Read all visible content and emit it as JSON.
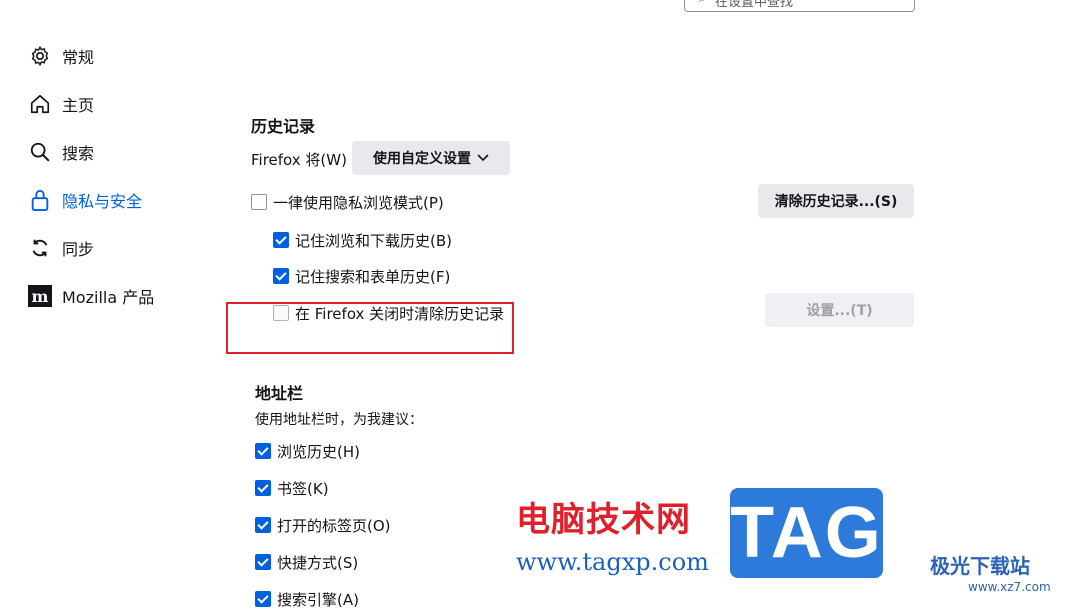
{
  "search": {
    "placeholder_visible": "在设置中查找"
  },
  "sidebar": {
    "items": [
      {
        "label": "常规",
        "icon": "gear-icon"
      },
      {
        "label": "主页",
        "icon": "home-icon"
      },
      {
        "label": "搜索",
        "icon": "search-icon"
      },
      {
        "label": "隐私与安全",
        "icon": "lock-icon",
        "active": true
      },
      {
        "label": "同步",
        "icon": "sync-icon"
      },
      {
        "label": "Mozilla 产品",
        "icon": "mozilla-icon"
      }
    ]
  },
  "history": {
    "title": "历史记录",
    "firefox_will_label": "Firefox 将(W)",
    "mode_select": "使用自定义设置",
    "always_private": {
      "label": "一律使用隐私浏览模式(P)",
      "checked": false
    },
    "clear_button": "清除历史记录...(S)",
    "remember_browsing": {
      "label": "记住浏览和下载历史(B)",
      "checked": true
    },
    "remember_search": {
      "label": "记住搜索和表单历史(F)",
      "checked": true
    },
    "clear_on_close": {
      "label": "在 Firefox 关闭时清除历史记录",
      "checked": false
    },
    "settings_button": "设置...(T)"
  },
  "addressbar": {
    "title": "地址栏",
    "subtitle": "使用地址栏时，为我建议：",
    "options": [
      {
        "label": "浏览历史(H)",
        "checked": true
      },
      {
        "label": "书签(K)",
        "checked": true
      },
      {
        "label": "打开的标签页(O)",
        "checked": true
      },
      {
        "label": "快捷方式(S)",
        "checked": true
      },
      {
        "label": "搜索引擎(A)",
        "checked": true
      }
    ]
  },
  "watermark": {
    "cn_text": "电脑技术网",
    "url": "www.tagxp.com",
    "tag": "TAG",
    "right_cn": "极光下载站",
    "right_url": "www.xz7.com"
  },
  "colors": {
    "accent": "#0061e0",
    "highlight": "#e0202a"
  }
}
